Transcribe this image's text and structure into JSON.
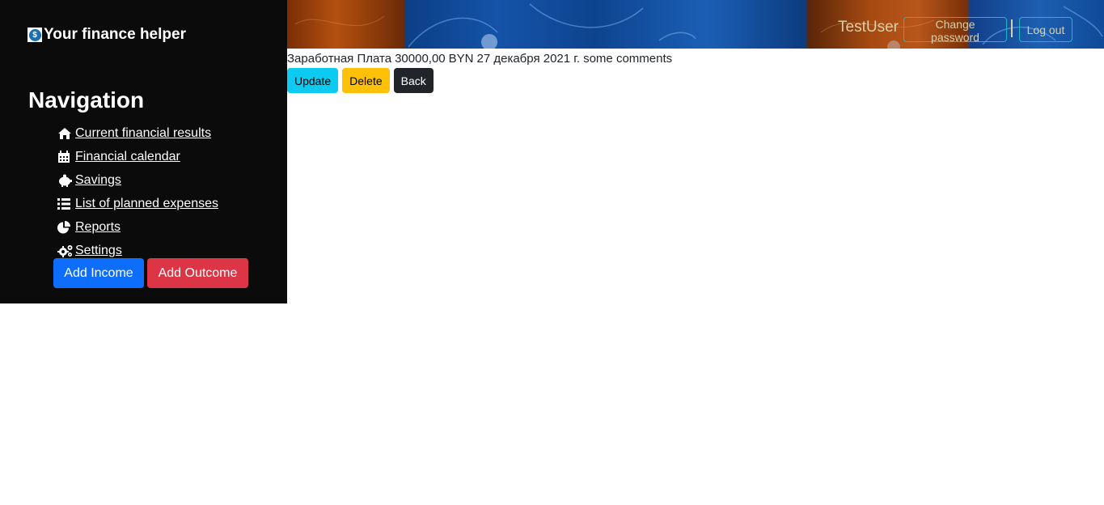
{
  "brand": {
    "title": "Your finance helper",
    "logo_glyph": "$",
    "logo_icon": "dollar-coin-icon"
  },
  "navigation": {
    "title": "Navigation",
    "items": [
      {
        "label": " Current financial results",
        "icon": "home-icon"
      },
      {
        "label": " Financial calendar",
        "icon": "calendar-icon"
      },
      {
        "label": " Savings",
        "icon": "piggy-bank-icon"
      },
      {
        "label": " List of planned expenses",
        "icon": "list-icon"
      },
      {
        "label": " Reports",
        "icon": "pie-chart-icon"
      },
      {
        "label": " Settings",
        "icon": "gears-icon"
      }
    ],
    "add_income_label": "Add Income",
    "add_outcome_label": "Add Outcome"
  },
  "header": {
    "user_name": "TestUser",
    "change_password_label": "Change password",
    "logout_label": "Log out"
  },
  "record": {
    "category": "Заработная Плата",
    "amount": "30000,00",
    "currency": "BYN",
    "date": "27 декабря 2021 г.",
    "comment": "some comments"
  },
  "actions": {
    "update_label": "Update",
    "delete_label": "Delete",
    "back_label": "Back"
  },
  "colors": {
    "sidebar_bg": "#0b0b0b",
    "primary": "#0d6efd",
    "danger": "#dc3545",
    "info": "#0dcaf0",
    "warning": "#ffc107",
    "dark": "#212529",
    "header_text": "#d8cfa8",
    "header_border": "#1fb6c8"
  }
}
